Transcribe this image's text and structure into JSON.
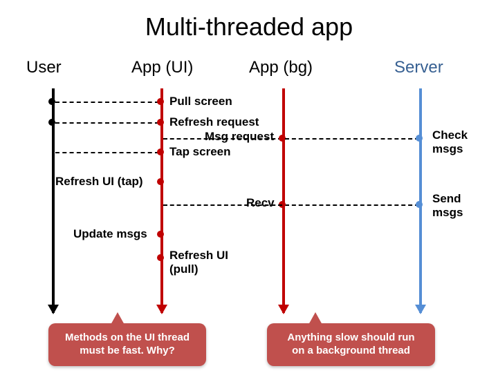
{
  "title": "Multi-threaded app",
  "lanes": {
    "user": "User",
    "ui": "App (UI)",
    "bg": "App (bg)",
    "server": "Server"
  },
  "labels": {
    "pull": "Pull screen",
    "refresh_req": "Refresh request",
    "msg_req": "Msg request",
    "tap": "Tap screen",
    "refresh_tap": "Refresh UI (tap)",
    "recv": "Recv",
    "update": "Update msgs",
    "refresh_pull": "Refresh UI\n(pull)",
    "check": "Check\nmsgs",
    "send": "Send\nmsgs"
  },
  "callouts": {
    "ui_fast": "Methods on the UI thread\nmust be fast. Why?",
    "bg_slow": "Anything slow should run\non a background thread"
  },
  "chart_data": {
    "type": "sequence",
    "participants": [
      "User",
      "App (UI)",
      "App (bg)",
      "Server"
    ],
    "messages": [
      {
        "from": "User",
        "to": "App (UI)",
        "label": "Pull screen"
      },
      {
        "from": "User",
        "to": "App (UI)",
        "label": "Refresh request"
      },
      {
        "from": "App (UI)",
        "to": "App (bg)",
        "label": "Msg request"
      },
      {
        "from": "User",
        "to": "App (UI)",
        "label": "Tap screen"
      },
      {
        "from": "App (UI)",
        "to": "App (UI)",
        "label": "Refresh UI (tap)",
        "self": true
      },
      {
        "from": "App (bg)",
        "to": "Server",
        "label": "Check msgs"
      },
      {
        "from": "Server",
        "to": "App (bg)",
        "label": "Send msgs"
      },
      {
        "from": "App (bg)",
        "to": "App (UI)",
        "label": "Recv"
      },
      {
        "from": "App (UI)",
        "to": "App (UI)",
        "label": "Update msgs",
        "self": true
      },
      {
        "from": "App (UI)",
        "to": "App (UI)",
        "label": "Refresh UI (pull)",
        "self": true
      }
    ],
    "notes": [
      {
        "on": "App (UI)",
        "text": "Methods on the UI thread must be fast. Why?"
      },
      {
        "on": "App (bg)",
        "text": "Anything slow should run on a background thread"
      }
    ]
  }
}
